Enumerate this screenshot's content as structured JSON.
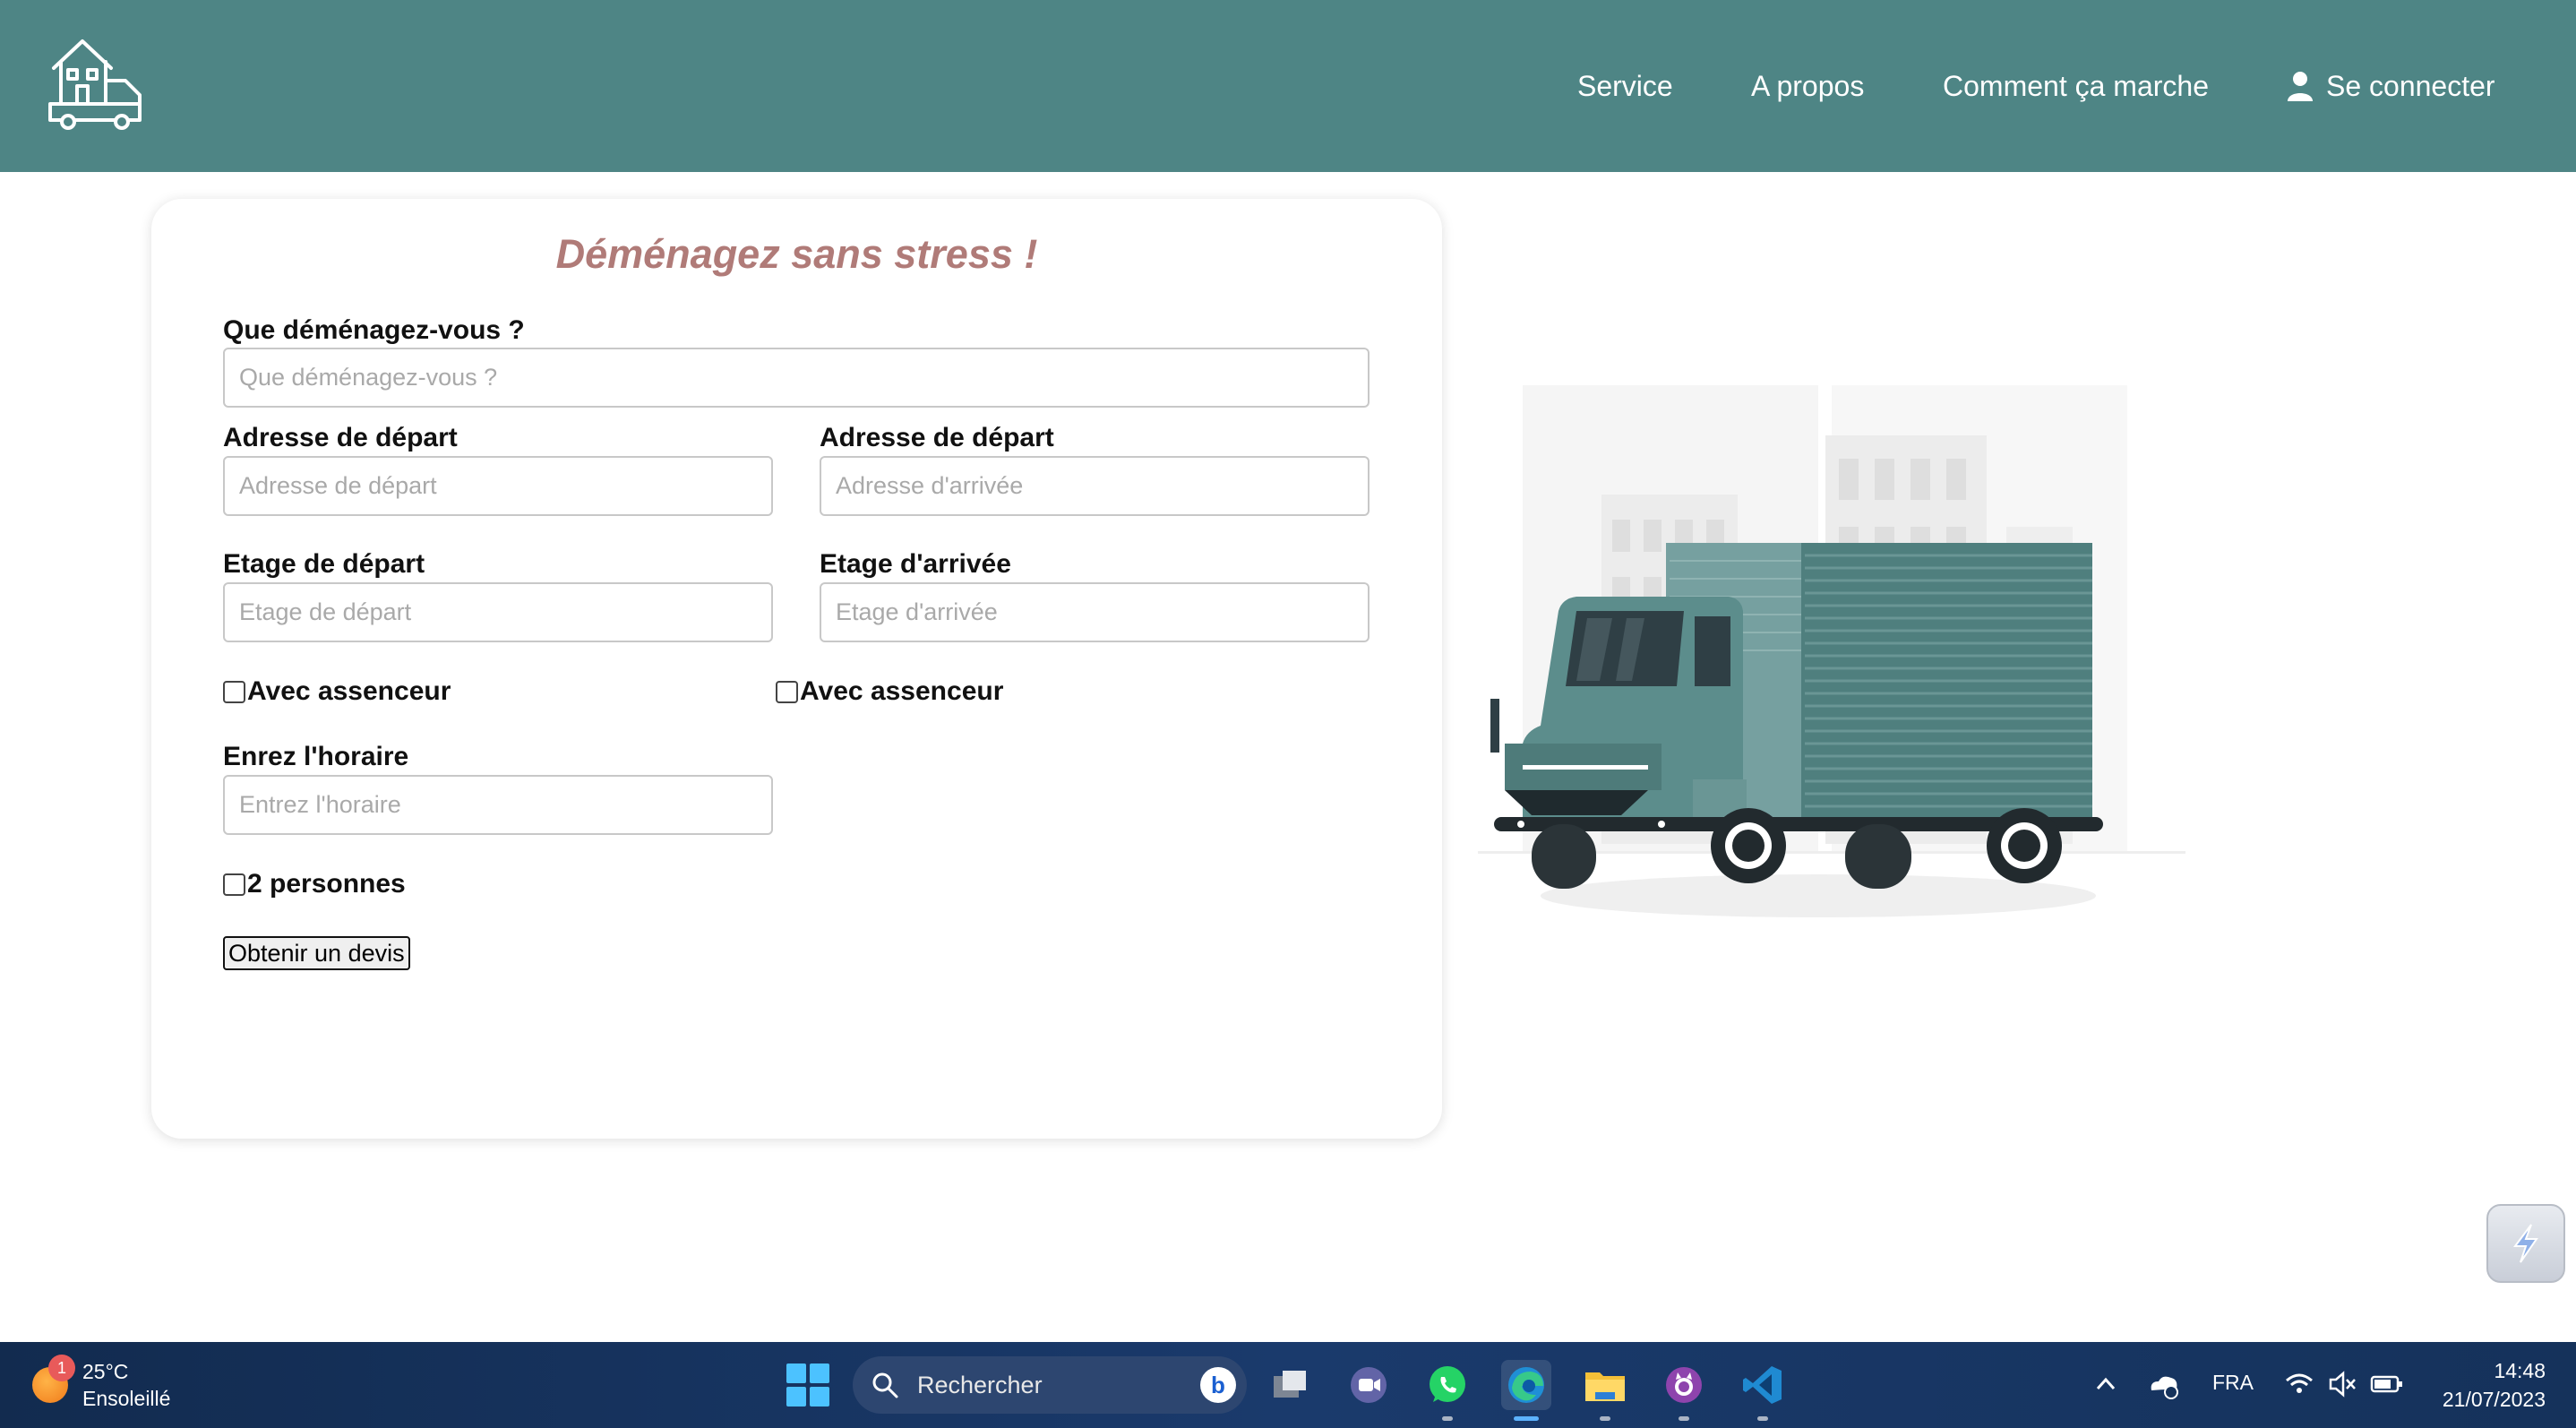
{
  "colors": {
    "navbar": "#4e8585",
    "title": "#b07b78",
    "truck_teal": "#4f7f7e",
    "taskbar": "#15325b"
  },
  "nav": {
    "logo_icon": "house-truck-icon",
    "links": [
      "Service",
      "A propos",
      "Comment ça marche"
    ],
    "login_label": "Se connecter",
    "login_icon": "user-icon"
  },
  "form": {
    "title": "Déménagez sans stress !",
    "what": {
      "label": "Que déménagez-vous ?",
      "placeholder": "Que déménagez-vous ?"
    },
    "from_address": {
      "label": "Adresse de départ",
      "placeholder": "Adresse de départ"
    },
    "to_address": {
      "label": "Adresse de départ",
      "placeholder": "Adresse d'arrivée"
    },
    "from_floor": {
      "label": "Etage de départ",
      "placeholder": "Etage de départ"
    },
    "to_floor": {
      "label": "Etage d'arrivée",
      "placeholder": "Etage d'arrivée"
    },
    "from_elevator": "Avec assenceur",
    "to_elevator": "Avec assenceur",
    "schedule": {
      "label": "Enrez l'horaire",
      "placeholder": "Entrez l'horaire"
    },
    "two_people": "2 personnes",
    "submit": "Obtenir un devis"
  },
  "illustration": {
    "icon": "moving-truck-illustration"
  },
  "taskbar": {
    "weather": {
      "temp": "25°C",
      "condition": "Ensoleillé",
      "badge": "1"
    },
    "search_placeholder": "Rechercher",
    "apps": [
      "task-view-icon",
      "teams-icon",
      "whatsapp-icon",
      "edge-icon",
      "file-explorer-icon",
      "github-desktop-icon",
      "vscode-icon"
    ],
    "language": "FRA",
    "time": "14:48",
    "date": "21/07/2023"
  }
}
